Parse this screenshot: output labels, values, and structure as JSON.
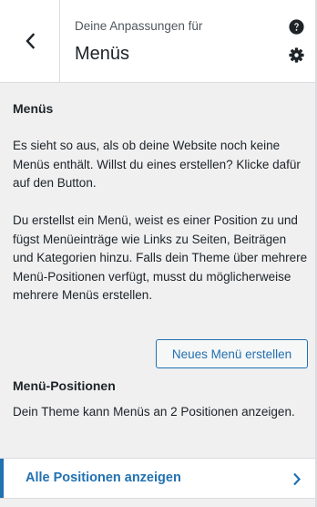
{
  "header": {
    "subtitle": "Deine Anpassungen für",
    "title": "Menüs",
    "back_icon": "chevron-left-icon",
    "help_icon": "help-icon",
    "settings_icon": "gear-icon"
  },
  "menus_section": {
    "title": "Menüs",
    "paragraph_1": "Es sieht so aus, als ob deine Website noch keine Menüs enthält. Willst du eines erstellen? Klicke dafür auf den Button.",
    "paragraph_2": "Du erstellst ein Menü, weist es einer Position zu und fügst Menüeinträge wie Links zu Seiten, Beiträgen und Kategorien hinzu. Falls dein Theme über mehrere Menü-Positionen verfügt, musst du möglicherweise mehrere Menüs erstellen.",
    "new_menu_button": "Neues Menü erstellen"
  },
  "positions_section": {
    "title": "Menü-Positionen",
    "text": "Dein Theme kann Menüs an 2 Positionen anzeigen.",
    "all_positions_link": "Alle Positionen anzeigen",
    "chevron_icon": "chevron-right-icon"
  },
  "colors": {
    "accent": "#2271b1",
    "panel_background": "#f0f0f1",
    "text": "#1d2327"
  }
}
